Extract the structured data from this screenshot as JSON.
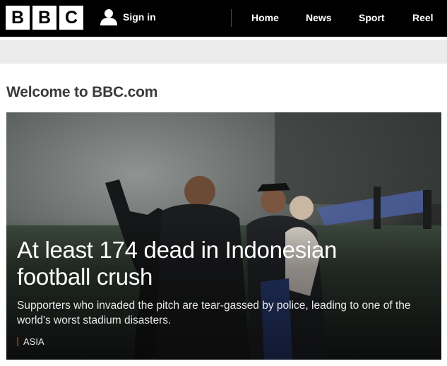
{
  "header": {
    "logo_letters": [
      "B",
      "B",
      "C"
    ],
    "signin_label": "Sign in",
    "nav": [
      "Home",
      "News",
      "Sport",
      "Reel"
    ]
  },
  "page": {
    "welcome": "Welcome to BBC.com"
  },
  "hero": {
    "title": "At least 174 dead in Indonesian football crush",
    "summary": "Supporters who invaded the pitch are tear-gassed by police, leading to one of the world's worst stadium disasters.",
    "tag": "ASIA",
    "tag_color": "#d00e0e"
  },
  "colors": {
    "topbar": "#000000",
    "grey_strip": "#ececec",
    "welcome_text": "#3a3a3a"
  }
}
